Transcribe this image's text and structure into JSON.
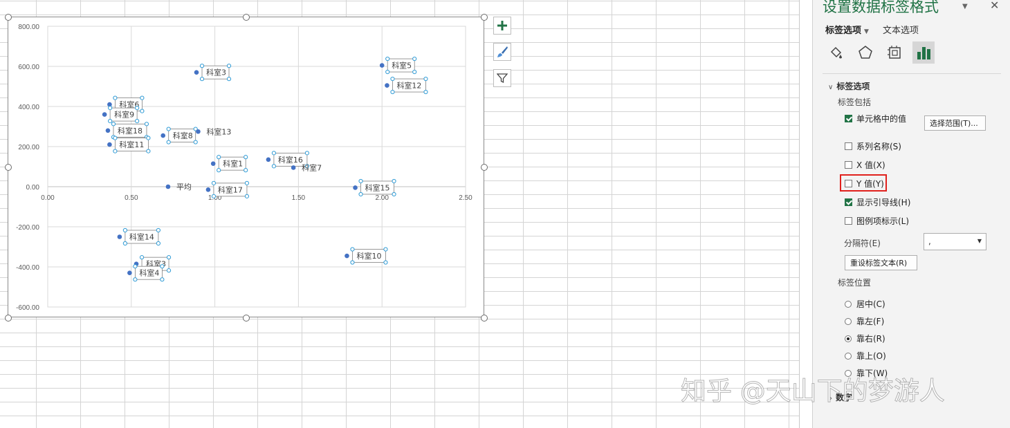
{
  "pane": {
    "title": "设置数据标签格式",
    "dropdown_glyph": "▼",
    "close_glyph": "✕",
    "tabs": {
      "label_options": "标签选项",
      "text_options": "文本选项"
    },
    "category_icons": [
      "fill-line-icon",
      "effects-icon",
      "size-properties-icon",
      "label-options-icon"
    ],
    "section_label_options": "标签选项",
    "label_contains_heading": "标签包括",
    "options": [
      {
        "label": "单元格中的值",
        "checked": true
      },
      {
        "label": "系列名称(S)",
        "checked": false
      },
      {
        "label": "X 值(X)",
        "checked": false
      },
      {
        "label": "Y 值(Y)",
        "checked": false
      },
      {
        "label": "显示引导线(H)",
        "checked": true
      },
      {
        "label": "图例项标示(L)",
        "checked": false
      }
    ],
    "select_range_button": "选择范围(T)...",
    "separator_label": "分隔符(E)",
    "separator_value": ",",
    "reset_button": "重设标签文本(R)",
    "label_position_heading": "标签位置",
    "positions": [
      {
        "label": "居中(C)",
        "checked": false
      },
      {
        "label": "靠左(F)",
        "checked": false
      },
      {
        "label": "靠右(R)",
        "checked": true
      },
      {
        "label": "靠上(O)",
        "checked": false
      },
      {
        "label": "靠下(W)",
        "checked": false
      }
    ],
    "number_section": "数字"
  },
  "chart_tools": {
    "add_element": "chart-elements-plus-icon",
    "styles": "chart-styles-brush-icon",
    "filters": "chart-filters-funnel-icon"
  },
  "watermark": "知乎 @天山下的梦游人",
  "chart_data": {
    "type": "scatter",
    "xlim": [
      0,
      2.5
    ],
    "ylim": [
      -600,
      800
    ],
    "x_ticks": [
      "0.00",
      "0.50",
      "1.00",
      "1.50",
      "2.00",
      "2.50"
    ],
    "y_ticks": [
      "800.00",
      "600.00",
      "400.00",
      "200.00",
      "0.00",
      "-200.00",
      "-400.00",
      "-600.00"
    ],
    "grid": true,
    "point_color": "#4472c4",
    "points": [
      {
        "x": 0.89,
        "y": 570,
        "label": "科室3"
      },
      {
        "x": 2.0,
        "y": 605,
        "label": "科室5"
      },
      {
        "x": 2.03,
        "y": 505,
        "label": "科室12"
      },
      {
        "x": 0.37,
        "y": 410,
        "label": "科室6"
      },
      {
        "x": 0.34,
        "y": 360,
        "label": "科室9"
      },
      {
        "x": 0.36,
        "y": 280,
        "label": "科室18"
      },
      {
        "x": 0.69,
        "y": 255,
        "label": "科室8"
      },
      {
        "x": 0.9,
        "y": 275,
        "label": "科室13"
      },
      {
        "x": 0.37,
        "y": 210,
        "label": "科室11"
      },
      {
        "x": 0.99,
        "y": 115,
        "label": "科室1"
      },
      {
        "x": 1.32,
        "y": 135,
        "label": "科室16"
      },
      {
        "x": 1.47,
        "y": 95,
        "label": "科室7"
      },
      {
        "x": 0.72,
        "y": 0,
        "label": "平均"
      },
      {
        "x": 0.96,
        "y": -15,
        "label": "科室17"
      },
      {
        "x": 1.84,
        "y": -5,
        "label": "科室15"
      },
      {
        "x": 0.43,
        "y": -250,
        "label": "科室14"
      },
      {
        "x": 1.79,
        "y": -345,
        "label": "科室10"
      },
      {
        "x": 0.53,
        "y": -385,
        "label": "科室3"
      },
      {
        "x": 0.49,
        "y": -430,
        "label": "科室4"
      }
    ]
  }
}
